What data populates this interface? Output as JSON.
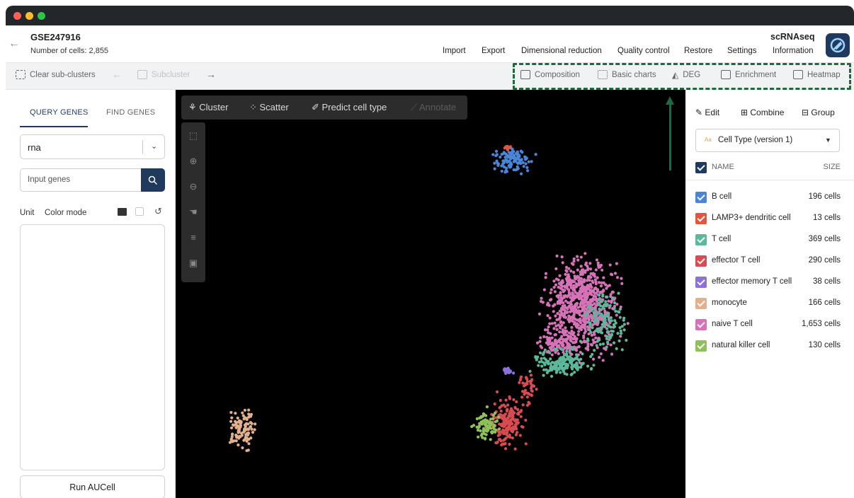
{
  "window": {
    "dots": [
      "#ff5f57",
      "#febc2e",
      "#28c840"
    ]
  },
  "header": {
    "title": "GSE247916",
    "cell_count": "Number of cells: 2,855",
    "mode": "scRNAseq",
    "menu": [
      "Import",
      "Export",
      "Dimensional reduction",
      "Quality control",
      "Restore",
      "Settings",
      "Information"
    ]
  },
  "toolbar": {
    "clear": "Clear sub-clusters",
    "subcluster": "Subcluster",
    "right": [
      "Composition",
      "Basic charts",
      "DEG",
      "Enrichment",
      "Heatmap"
    ]
  },
  "left": {
    "tabs": [
      "QUERY GENES",
      "FIND GENES"
    ],
    "assay": "rna",
    "input_placeholder": "Input genes",
    "unit_label": "Unit",
    "color_mode_label": "Color mode",
    "run_label": "Run AUCell"
  },
  "plot": {
    "toolbar": [
      "Cluster",
      "Scatter",
      "Predict cell type",
      "Annotate"
    ]
  },
  "right": {
    "actions": [
      "Edit",
      "Combine",
      "Group"
    ],
    "select_value": "Cell Type (version 1)",
    "col_name": "NAME",
    "col_size": "SIZE",
    "rows": [
      {
        "name": "B cell",
        "size": "196 cells",
        "color": "#4a85d6"
      },
      {
        "name": "LAMP3+ dendritic cell",
        "size": "13 cells",
        "color": "#e2553e"
      },
      {
        "name": "T cell",
        "size": "369 cells",
        "color": "#5bb89a"
      },
      {
        "name": "effector T cell",
        "size": "290 cells",
        "color": "#d84b50"
      },
      {
        "name": "effector memory T cell",
        "size": "38 cells",
        "color": "#8b72d9"
      },
      {
        "name": "monocyte",
        "size": "166 cells",
        "color": "#e2b08c"
      },
      {
        "name": "naive T cell",
        "size": "1,653 cells",
        "color": "#d672b8"
      },
      {
        "name": "natural killer cell",
        "size": "130 cells",
        "color": "#8fc15a"
      }
    ]
  },
  "colors": {
    "accent": "#1f3a5c",
    "highlight": "#1d6b3c",
    "checkbox": "#1f3a5c"
  }
}
